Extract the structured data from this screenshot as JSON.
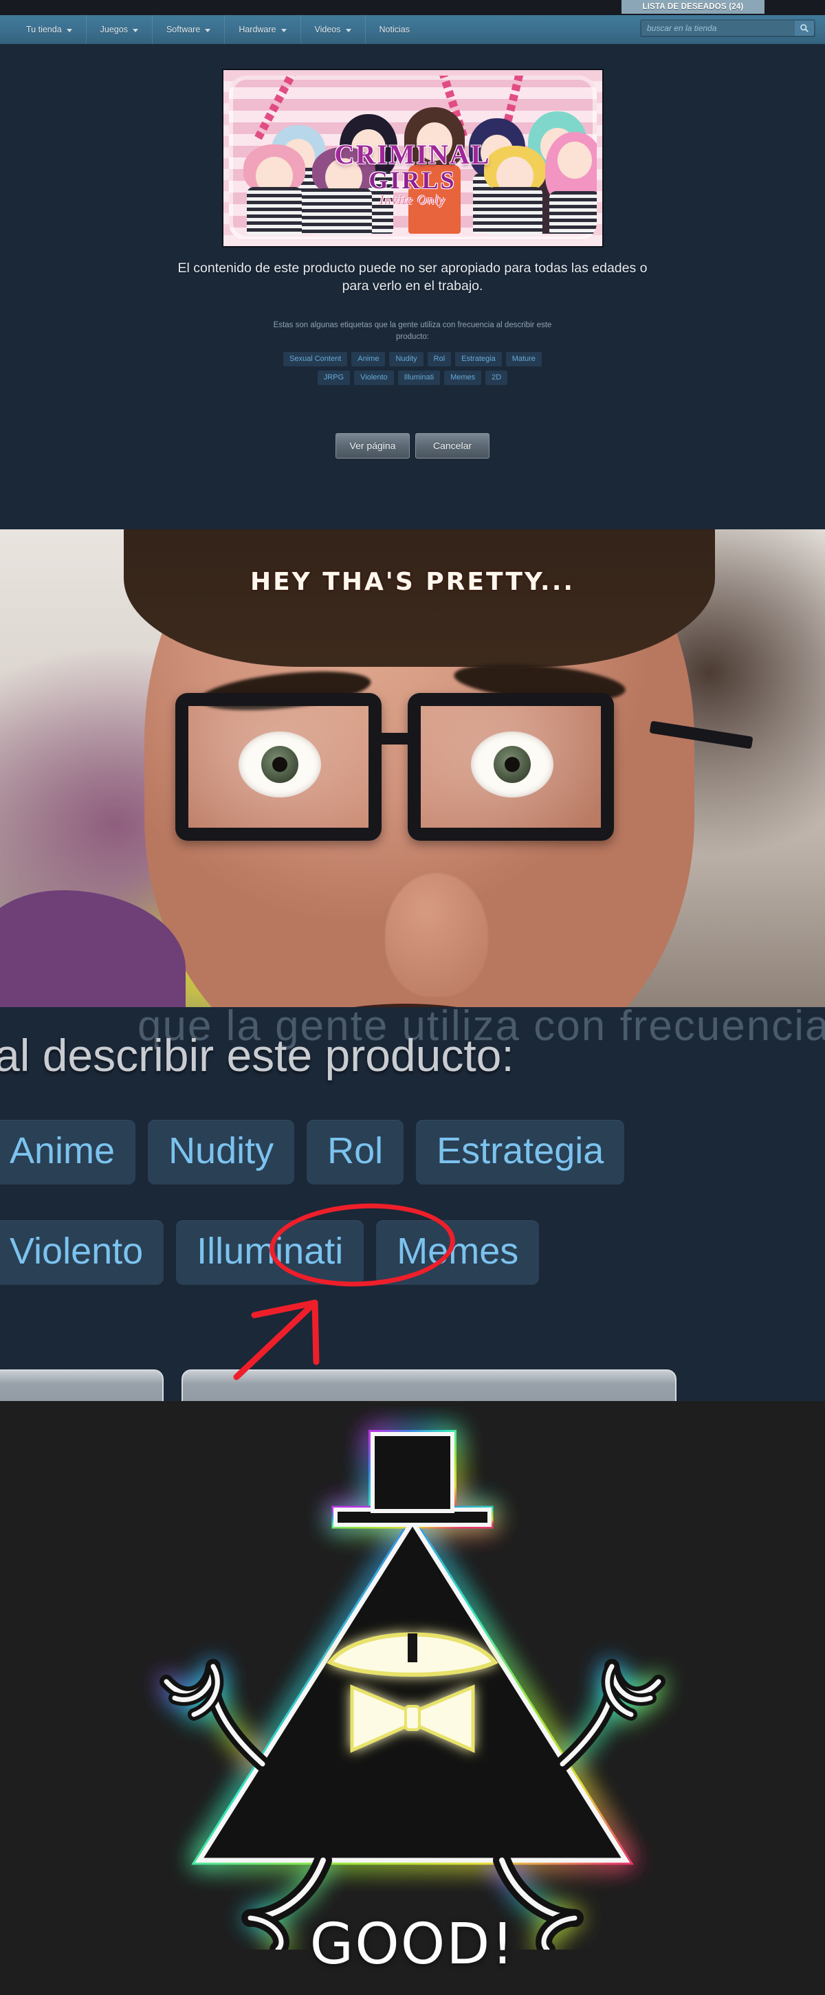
{
  "meta": {
    "layout": "4-panel vertical meme strip",
    "accent_blue": "#67a9d4",
    "steam_bg": "#1b2838",
    "steam_nav": "#417a9b",
    "tag_bg": "#243b52",
    "marker_red": "#ee1f2a"
  },
  "steam": {
    "wishlist_label": "LISTA DE DESEADOS (24)",
    "nav_items": [
      {
        "label": "Tu tienda",
        "has_caret": true
      },
      {
        "label": "Juegos",
        "has_caret": true
      },
      {
        "label": "Software",
        "has_caret": true
      },
      {
        "label": "Hardware",
        "has_caret": true
      },
      {
        "label": "Videos",
        "has_caret": true
      },
      {
        "label": "Noticias",
        "has_caret": false
      }
    ],
    "search": {
      "placeholder": "buscar en la tienda",
      "value": "",
      "icon": "search-icon"
    },
    "banner": {
      "title_line1": "CRIMINAL",
      "title_line2": "GIRLS",
      "title_line3": "Invite Only",
      "alt": "anime game cover art with girls in striped prison outfits"
    },
    "age_gate": {
      "warning": "El contenido de este producto puede no ser apropiado para todas las edades o para verlo en el trabajo.",
      "tags_intro": "Estas son algunas etiquetas que la gente utiliza con frecuencia al describir este producto:",
      "tags_row1": [
        "Sexual Content",
        "Anime",
        "Nudity",
        "Rol",
        "Estrategia",
        "Mature"
      ],
      "tags_row2": [
        "JRPG",
        "Violento",
        "Illuminati",
        "Memes",
        "2D"
      ],
      "view_button": "Ver página",
      "cancel_button": "Cancelar"
    }
  },
  "meme_photo": {
    "caption": "HEY THA'S PRETTY...",
    "alt": "close-up of surprised man with thick black glasses"
  },
  "zoom_panel": {
    "ghost_line": "que la gente utiliza con frecuencia",
    "headline": "al describir este producto:",
    "big_tags_row1": [
      "Anime",
      "Nudity",
      "Rol",
      "Estrategia"
    ],
    "big_tags_row2": [
      "Violento",
      "Illuminati",
      "Memes"
    ],
    "highlighted_tag": "Illuminati",
    "annotation": {
      "shape": "ellipse",
      "color": "#ee1f2a",
      "arrow": true
    }
  },
  "cipher_panel": {
    "caption": "GOOD!",
    "alt": "Bill Cipher triangle with top hat, bow tie and neon rainbow glow",
    "glow_colors": [
      "#c33bf0",
      "#3b8ef0",
      "#37f0c6",
      "#9bf03b",
      "#f0e63b",
      "#f03b6e"
    ]
  }
}
